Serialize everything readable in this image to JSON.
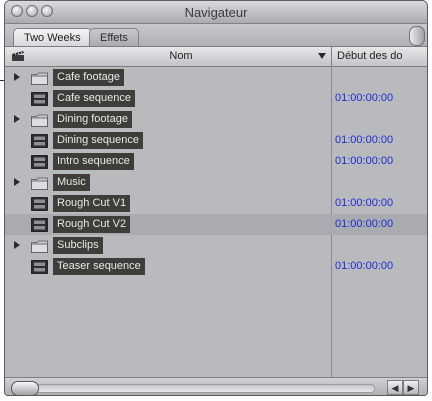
{
  "window": {
    "title": "Navigateur"
  },
  "tabs": [
    {
      "label": "Two Weeks",
      "active": true
    },
    {
      "label": "Effets",
      "active": false
    }
  ],
  "columns": {
    "name": "Nom",
    "start": "Début des do"
  },
  "items": [
    {
      "type": "folder",
      "name": "Cafe footage",
      "start": ""
    },
    {
      "type": "sequence",
      "name": "Cafe sequence",
      "start": "01:00:00:00"
    },
    {
      "type": "folder",
      "name": "Dining footage",
      "start": ""
    },
    {
      "type": "sequence",
      "name": "Dining sequence",
      "start": "01:00:00:00"
    },
    {
      "type": "sequence",
      "name": "Intro sequence",
      "start": "01:00:00:00"
    },
    {
      "type": "folder",
      "name": "Music",
      "start": ""
    },
    {
      "type": "sequence",
      "name": "Rough Cut V1",
      "start": "01:00:00:00"
    },
    {
      "type": "sequence",
      "name": "Rough Cut V2",
      "start": "01:00:00:00",
      "selected": true
    },
    {
      "type": "folder",
      "name": "Subclips",
      "start": ""
    },
    {
      "type": "sequence",
      "name": "Teaser sequence",
      "start": "01:00:00:00"
    }
  ],
  "colors": {
    "label_bg": "#3e3d3a",
    "label_text": "#e9e9e6",
    "timecode": "#1f2bd0",
    "list_bg": "#b8babe"
  }
}
